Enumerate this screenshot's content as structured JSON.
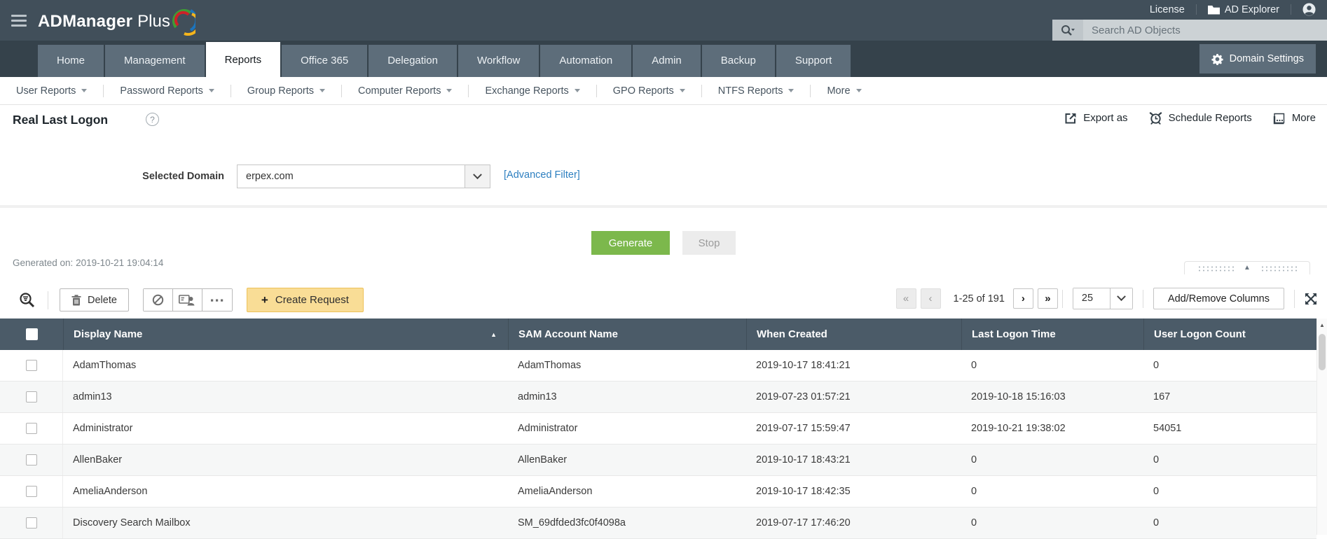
{
  "topbar": {
    "product_name": "ADManager",
    "product_suffix": "Plus",
    "license_label": "License",
    "ad_explorer_label": "AD Explorer",
    "search_placeholder": "Search AD Objects"
  },
  "nav": {
    "tabs": [
      {
        "label": "Home"
      },
      {
        "label": "Management"
      },
      {
        "label": "Reports",
        "active": true
      },
      {
        "label": "Office 365"
      },
      {
        "label": "Delegation"
      },
      {
        "label": "Workflow"
      },
      {
        "label": "Automation"
      },
      {
        "label": "Admin"
      },
      {
        "label": "Backup"
      },
      {
        "label": "Support"
      }
    ],
    "domain_settings_label": "Domain Settings"
  },
  "subnav": {
    "items": [
      "User Reports",
      "Password Reports",
      "Group Reports",
      "Computer Reports",
      "Exchange Reports",
      "GPO Reports",
      "NTFS Reports",
      "More"
    ]
  },
  "page": {
    "title": "Real Last Logon",
    "export_label": "Export as",
    "schedule_label": "Schedule Reports",
    "more_label": "More"
  },
  "filter": {
    "domain_label": "Selected Domain",
    "selected_domain": "erpex.com",
    "advanced_filter_label": "[Advanced Filter]"
  },
  "actions": {
    "generate_label": "Generate",
    "stop_label": "Stop",
    "generated_on": "Generated on: 2019-10-21 19:04:14"
  },
  "toolbar": {
    "delete_label": "Delete",
    "create_request_label": "Create Request",
    "range_label": "1-25 of 191",
    "page_size": "25",
    "add_remove_columns_label": "Add/Remove Columns"
  },
  "icons": {
    "help": "?",
    "plus": "+",
    "first": "«",
    "prev": "‹",
    "next": "›",
    "last": "»",
    "sort_asc": "▲",
    "collapse_up": "▲",
    "scroll_up": "▲"
  },
  "colors": {
    "topbar_bg": "#414f5a",
    "navbar_bg": "#35424b",
    "tab_bg": "#5d6d7a",
    "table_header_bg": "#4b5b68",
    "generate_green": "#7cb84c",
    "create_request_yellow": "#f9dd96",
    "link_blue": "#2d7fc0"
  },
  "table": {
    "columns": [
      "Display Name",
      "SAM Account Name",
      "When Created",
      "Last Logon Time",
      "User Logon Count"
    ],
    "rows": [
      {
        "display_name": "AdamThomas",
        "sam": "AdamThomas",
        "created": "2019-10-17 18:41:21",
        "last_logon": "0",
        "count": "0"
      },
      {
        "display_name": "admin13",
        "sam": "admin13",
        "created": "2019-07-23 01:57:21",
        "last_logon": "2019-10-18 15:16:03",
        "count": "167"
      },
      {
        "display_name": "Administrator",
        "sam": "Administrator",
        "created": "2019-07-17 15:59:47",
        "last_logon": "2019-10-21 19:38:02",
        "count": "54051"
      },
      {
        "display_name": "AllenBaker",
        "sam": "AllenBaker",
        "created": "2019-10-17 18:43:21",
        "last_logon": "0",
        "count": "0"
      },
      {
        "display_name": "AmeliaAnderson",
        "sam": "AmeliaAnderson",
        "created": "2019-10-17 18:42:35",
        "last_logon": "0",
        "count": "0"
      },
      {
        "display_name": "Discovery Search Mailbox",
        "sam": "SM_69dfded3fc0f4098a",
        "created": "2019-07-17 17:46:20",
        "last_logon": "0",
        "count": "0"
      }
    ]
  }
}
